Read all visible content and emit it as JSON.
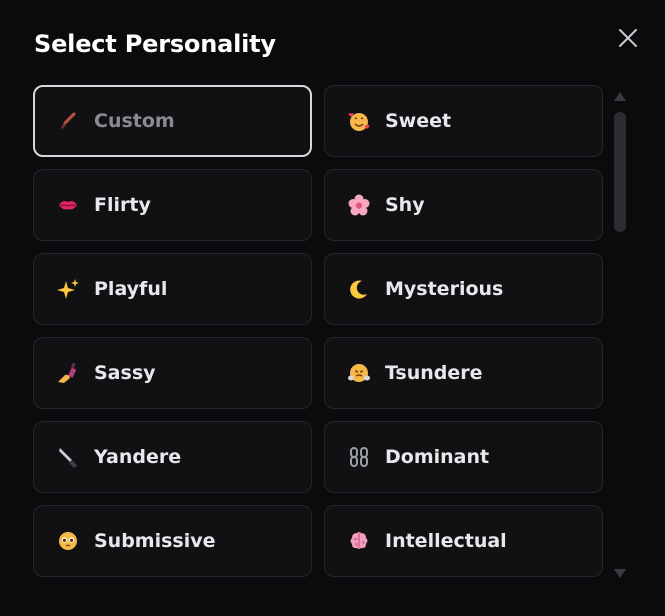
{
  "dialog": {
    "title": "Select Personality",
    "close_icon": "close-icon"
  },
  "personalities": [
    {
      "label": "Custom",
      "icon": "paintbrush-icon",
      "selected": true
    },
    {
      "label": "Sweet",
      "icon": "smiling-face-with-hearts-icon",
      "selected": false
    },
    {
      "label": "Flirty",
      "icon": "kiss-mark-icon",
      "selected": false
    },
    {
      "label": "Shy",
      "icon": "cherry-blossom-icon",
      "selected": false
    },
    {
      "label": "Playful",
      "icon": "sparkles-icon",
      "selected": false
    },
    {
      "label": "Mysterious",
      "icon": "crescent-moon-icon",
      "selected": false
    },
    {
      "label": "Sassy",
      "icon": "nail-polish-icon",
      "selected": false
    },
    {
      "label": "Tsundere",
      "icon": "face-with-steam-icon",
      "selected": false
    },
    {
      "label": "Yandere",
      "icon": "knife-icon",
      "selected": false
    },
    {
      "label": "Dominant",
      "icon": "chains-icon",
      "selected": false
    },
    {
      "label": "Submissive",
      "icon": "pleading-face-icon",
      "selected": false
    },
    {
      "label": "Intellectual",
      "icon": "brain-icon",
      "selected": false
    }
  ],
  "colors": {
    "background": "#0b0b0d",
    "card": "#111114",
    "card_border": "#25252b",
    "selected_border": "#d8d8dc"
  }
}
